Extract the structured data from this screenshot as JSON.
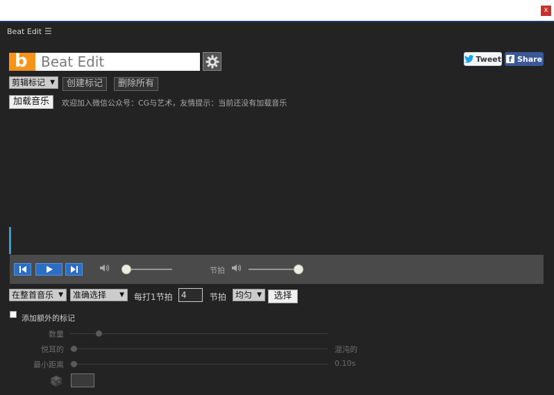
{
  "window": {
    "close_label": "x"
  },
  "panel": {
    "tab_title": "Beat Edit",
    "menu_icon": "hamburger-icon"
  },
  "header": {
    "logo_letter": "b",
    "logo_text": "Beat Edit",
    "tweet_label": "Tweet",
    "share_label": "Share",
    "brand_color": "#f4941d"
  },
  "toolbar": {
    "mark_select": "剪辑标记",
    "create_mark": "创建标记",
    "delete_all": "删除所有",
    "load_music": "加载音乐",
    "welcome_text": "欢迎加入微信公众号：CG与艺术，友情提示：当前还没有加载音乐"
  },
  "transport": {
    "beat_label": "节拍",
    "volume_level": 0,
    "beat_volume_level": 1
  },
  "controls": {
    "range_select": "在整首音乐",
    "mode_select": "准确选择",
    "every_label": "每打1节拍",
    "beat_count": "4",
    "beat_label": "节拍",
    "distribution_select": "均匀",
    "select_button": "选择"
  },
  "extra": {
    "checkbox_label": "添加额外的标记",
    "count_label": "数量",
    "pleasing_label": "悦耳的",
    "chaotic_label": "混沌的",
    "min_distance_label": "最小距离",
    "min_distance_value": "0.10s"
  }
}
